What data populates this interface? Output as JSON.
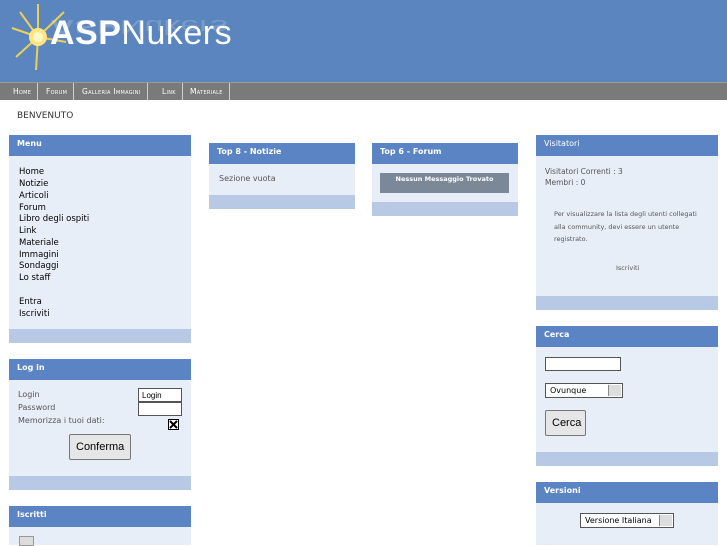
{
  "header": {
    "logo_bold": "ASP",
    "logo_rest": "Nukers"
  },
  "nav": [
    "Home",
    "Forum",
    "Galleria Immagini",
    "Link",
    "Materiale"
  ],
  "welcome": "BENVENUTO",
  "menu": {
    "title": "Menu",
    "items": [
      "Home",
      "Notizie",
      "Articoli",
      "Forum",
      "Libro degli ospiti",
      "Link",
      "Materiale",
      "Immagini",
      "Sondaggi",
      "Lo staff"
    ],
    "items2": [
      "Entra",
      "Iscriviti"
    ]
  },
  "login": {
    "title": "Log in",
    "login_label": "Login",
    "login_value": "Login",
    "password_label": "Password",
    "remember_label": "Memorizza i tuoi dati:",
    "submit": "Conferma"
  },
  "iscritti": {
    "title": "Iscritti"
  },
  "top_news": {
    "title": "Top 8 - Notizie",
    "empty": "Sezione vuota"
  },
  "top_forum": {
    "title": "Top 6 - Forum",
    "empty": "Nessun Messaggio Trovato"
  },
  "visitors": {
    "title": "Visitatori",
    "current": "Visitatori Correnti : 3",
    "members": "Membri : 0",
    "message": [
      "Per visualizzare la lista degli utenti collegati",
      "alla community, devi essere un utente",
      "registrato."
    ],
    "link": "Iscriviti"
  },
  "search": {
    "title": "Cerca",
    "scope": "Ovunque",
    "button": "Cerca"
  },
  "versions": {
    "title": "Versioni",
    "selected": "Versione Italiana"
  },
  "colors": {
    "header": "#5a85bf",
    "panel_head": "#5b84c4",
    "panel_body": "#e8eef8",
    "panel_foot": "#b7c9e4"
  }
}
